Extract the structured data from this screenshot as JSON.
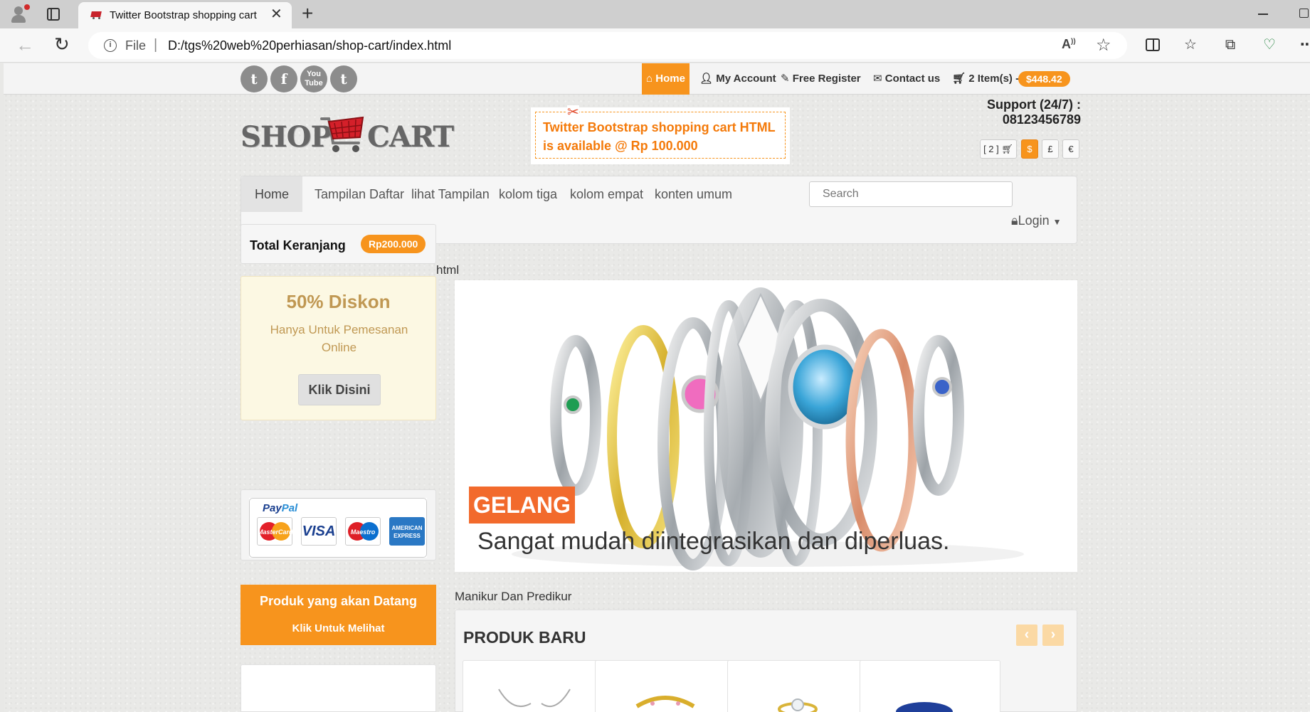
{
  "browser": {
    "tab_title": "Twitter Bootstrap shopping cart",
    "url_scheme": "File",
    "url": "D:/tgs%20web%20perhiasan/shop-cart/index.html",
    "icons": [
      "profile-icon",
      "tab-actions-icon",
      "close-icon",
      "plus-icon",
      "back-icon",
      "reload-icon",
      "info-icon",
      "read-aloud-icon",
      "star-icon",
      "split-screen-icon",
      "favorites-icon",
      "collections-icon",
      "performance-icon",
      "more-icon"
    ]
  },
  "topbar": {
    "social": [
      {
        "name": "twitter-icon",
        "glyph": "t"
      },
      {
        "name": "facebook-icon",
        "glyph": "f"
      },
      {
        "name": "youtube-icon",
        "glyph": "You Tube"
      },
      {
        "name": "tumblr-icon",
        "glyph": "t"
      }
    ],
    "nav": {
      "home": "Home",
      "account": "My Account",
      "register": "Free Register",
      "contact": "Contact us",
      "cart_items": "2 Item(s) -",
      "cart_total": "$448.42"
    }
  },
  "header": {
    "logo_left": "SHOP",
    "logo_right": "CART",
    "promo_line1": "Twitter Bootstrap shopping cart HTML",
    "promo_line2": "is available @ Rp 100.000",
    "support": "Support (24/7) : 08123456789",
    "mini_cart": "[ 2 ]",
    "currencies": [
      "$",
      "£",
      "€"
    ],
    "active_currency": "$",
    "accent": "#f7941d"
  },
  "navbar": {
    "items": [
      "Home",
      "Tampilan Daftar",
      "lihat Tampilan",
      "kolom tiga",
      "kolom empat",
      "konten umum"
    ],
    "active": "Home",
    "search_placeholder": "Search",
    "login": "Login"
  },
  "sidebar": {
    "total_label": "Total Keranjang",
    "total_value": "Rp200.000",
    "diskon_title": "50% Diskon",
    "diskon_text": "Hanya Untuk Pemesanan Online",
    "diskon_button": "Klik Disini",
    "paypal_prefix": "Pay",
    "paypal_suffix": "Pal",
    "cards": {
      "mastercard": "MasterCard",
      "visa": "VISA",
      "maestro": "Maestro",
      "amex": "AMERICAN EXPRESS"
    },
    "coming_title": "Produk yang akan Datang",
    "coming_link": "Klik Untuk Melihat"
  },
  "main": {
    "crumb": "html",
    "slide_label": "GELANG",
    "slide_caption": "Sangat mudah diintegrasikan dan diperluas.",
    "section_label": "Manikur Dan Predikur",
    "produk_title": "PRODUK BARU",
    "prev": "‹",
    "next": "›"
  }
}
